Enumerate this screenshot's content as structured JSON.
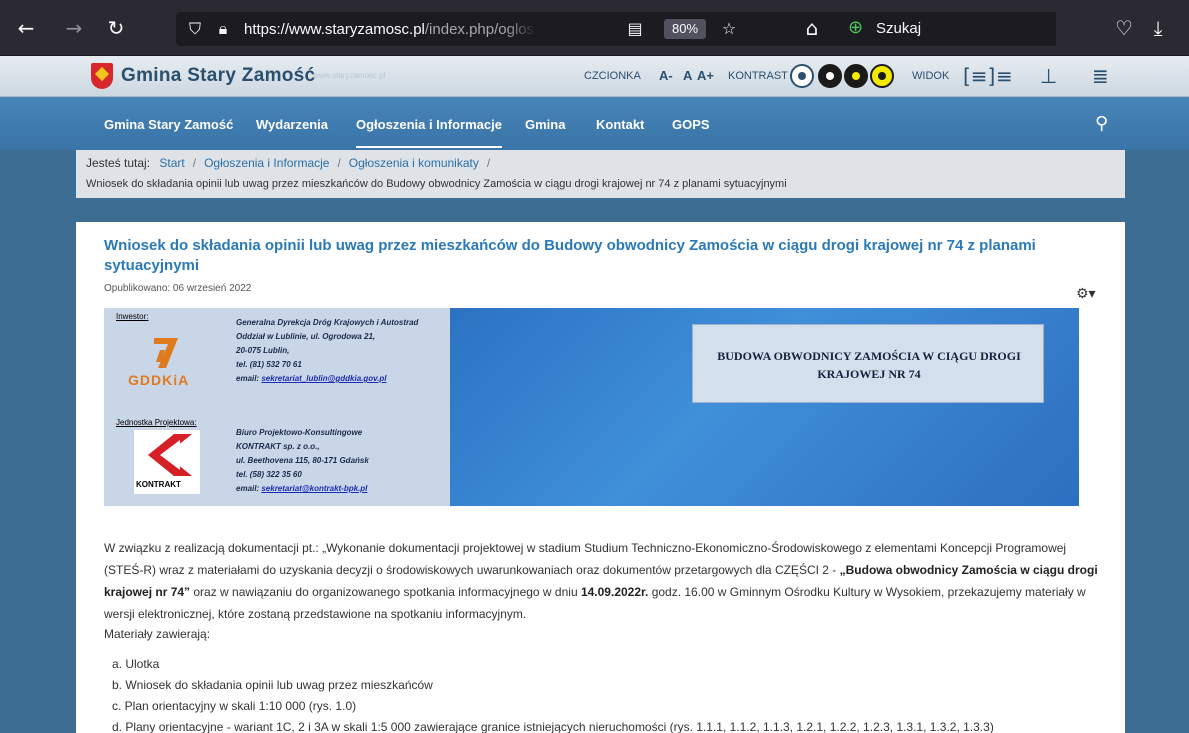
{
  "browser": {
    "back_icon": "arrow-left-icon",
    "forward_icon": "arrow-right-icon",
    "reload_icon": "reload-icon",
    "url_host": "https://www.staryzamosc.pl",
    "url_path": "/index.php/ogloszenia-inform",
    "zoom": "80%",
    "search_placeholder": "Szukaj"
  },
  "header": {
    "site_title": "Gmina Stary Zamość",
    "site_subtitle": "www.staryzamosc.pl",
    "font_label": "CZCIONKA",
    "font_smaller": "A-",
    "font_normal": "A",
    "font_larger": "A+",
    "contrast_label": "KONTRAST",
    "view_label": "WIDOK",
    "colors": {
      "primary": "#2c4f6e",
      "accent": "#3a74a8",
      "contrast_yellow": "#f2e800"
    }
  },
  "nav": {
    "items": [
      {
        "label": "Gmina Stary Zamość"
      },
      {
        "label": "Wydarzenia"
      },
      {
        "label": "Ogłoszenia i Informacje"
      },
      {
        "label": "Gmina"
      },
      {
        "label": "Kontakt"
      },
      {
        "label": "GOPS"
      }
    ],
    "active_index": 2
  },
  "breadcrumb": {
    "prefix": "Jesteś tutaj:",
    "items": [
      "Start",
      "Ogłoszenia i Informacje",
      "Ogłoszenia i komunikaty"
    ],
    "current": "Wniosek do składania opinii lub uwag przez mieszkańców do Budowy obwodnicy Zamościa w ciągu drogi krajowej nr 74 z planami sytuacyjnymi"
  },
  "article": {
    "title": "Wniosek do składania opinii lub uwag przez mieszkańców do Budowy obwodnicy Zamościa w ciągu drogi krajowej nr 74 z planami sytuacyjnymi",
    "published": "Opublikowano: 06 wrzesień 2022",
    "banner": {
      "investor_label": "Inwestor:",
      "investor_lines": [
        "Generalna Dyrekcja Dróg Krajowych i Autostrad",
        "Oddział w Lublinie, ul. Ogrodowa 21,",
        "20-075 Lublin,",
        "tel. (81) 532 70 61"
      ],
      "investor_email_prefix": "email: ",
      "investor_email": "sekretariat_lublin@gddkia.gov.pl",
      "gddkia_logo_text": "GDDKiA",
      "designer_label": "Jednostka Projektowa:",
      "designer_lines": [
        "Biuro Projektowo-Konsultingowe",
        "KONTRAKT sp. z o.o.,",
        "ul. Beethovena 115, 80-171 Gdańsk",
        "tel. (58) 322 35 60"
      ],
      "designer_email_prefix": "email: ",
      "designer_email": "sekretariat@kontrakt-bpk.pl",
      "kontrakt_logo_text": "KONTRAKT",
      "box_text": "BUDOWA OBWODNICY ZAMOŚCIA W CIĄGU DROGI KRAJOWEJ NR 74"
    },
    "body_parts": [
      "W związku z realizacją dokumentacji pt.: „Wykonanie dokumentacji projektowej w stadium Studium Techniczno-Ekonomiczno-Środowiskowego z elementami Koncepcji Programowej (STEŚ-R) wraz z materiałami do uzyskania decyzji o środowiskowych uwarunkowaniach oraz dokumentów przetargowych dla CZĘŚCI 2 - ",
      "„Budowa obwodnicy Zamościa w ciągu drogi krajowej nr 74”",
      " oraz w nawiązaniu do organizowanego spotkania informacyjnego w dniu ",
      "14.09.2022r.",
      " godz. 16.00 w Gminnym Ośrodku Kultury w Wysokiem, przekazujemy materiały w wersji elektronicznej, które zostaną przedstawione na spotkaniu informacyjnym."
    ],
    "materials_label": "Materiały zawierają:",
    "materials": [
      "a. Ulotka",
      "b. Wniosek do składania opinii lub uwag przez mieszkańców",
      "c. Plan orientacyjny w skali 1:10 000 (rys. 1.0)",
      "d. Plany orientacyjne - wariant 1C, 2 i 3A w skali 1:5 000 zawierające granice istniejących nieruchomości (rys. 1.1.1, 1.1.2, 1.1.3, 1.2.1, 1.2.2, 1.2.3, 1.3.1, 1.3.2, 1.3.3)"
    ]
  }
}
